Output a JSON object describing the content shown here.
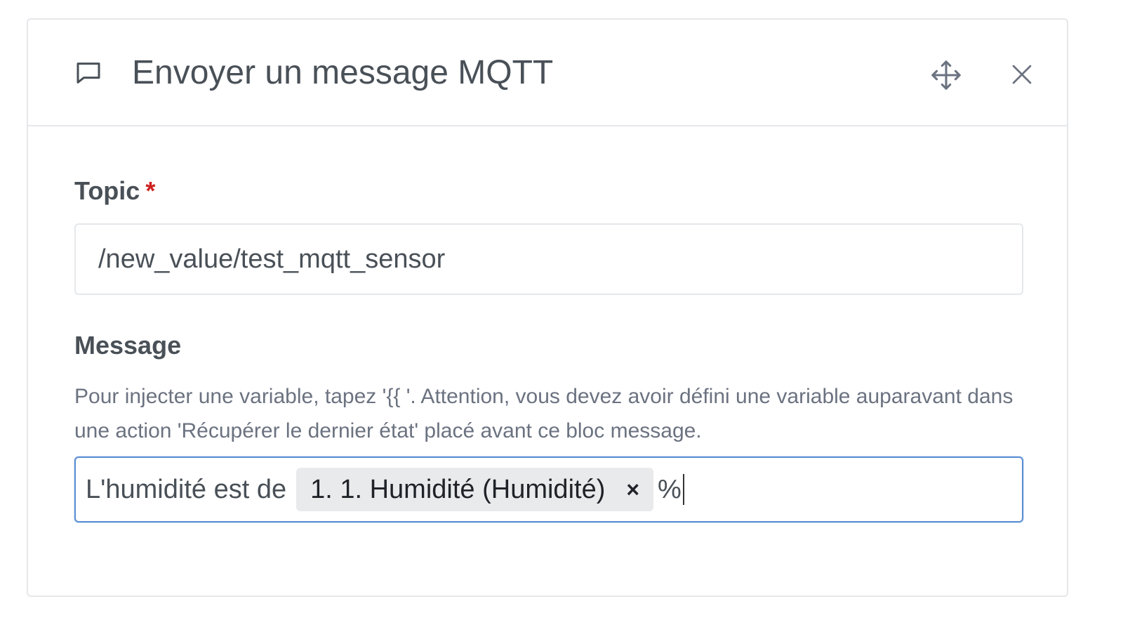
{
  "header": {
    "title": "Envoyer un message MQTT",
    "icon": "message-square-icon",
    "move_icon": "move-icon",
    "close_icon": "close-icon"
  },
  "topic": {
    "label": "Topic",
    "required_mark": "*",
    "value": "/new_value/test_mqtt_sensor"
  },
  "message": {
    "label": "Message",
    "help_text": "Pour injecter une variable, tapez '{{ '. Attention, vous devez avoir défini une variable auparavant dans une action 'Récupérer le dernier état' placé avant ce bloc message.",
    "text_before": "L'humidité est de",
    "variable_chip": "1. 1. Humidité (Humidité)",
    "chip_remove": "×",
    "text_after": "%"
  },
  "colors": {
    "required": "#cd201f",
    "focus_border": "#5b8fd4",
    "border": "#e5e7ea",
    "chip_bg": "#e9eaec"
  }
}
